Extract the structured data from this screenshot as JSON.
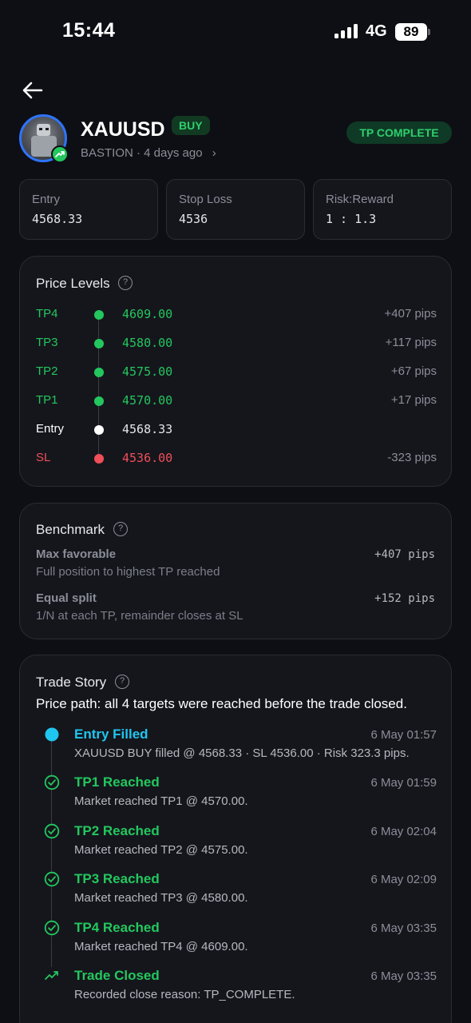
{
  "status": {
    "time": "15:44",
    "network": "4G",
    "battery": "89"
  },
  "header": {
    "symbol": "XAUUSD",
    "direction": "BUY",
    "subline": "BASTION · 4 days ago",
    "status_badge": "TP COMPLETE"
  },
  "stats": [
    {
      "label": "Entry",
      "value": "4568.33"
    },
    {
      "label": "Stop Loss",
      "value": "4536"
    },
    {
      "label": "Risk:Reward",
      "value": "1 : 1.3"
    }
  ],
  "price_levels": {
    "title": "Price Levels",
    "rows": [
      {
        "name": "TP4",
        "price": "4609.00",
        "pips": "+407 pips",
        "color": "#23c75e"
      },
      {
        "name": "TP3",
        "price": "4580.00",
        "pips": "+117 pips",
        "color": "#23c75e"
      },
      {
        "name": "TP2",
        "price": "4575.00",
        "pips": "+67 pips",
        "color": "#23c75e"
      },
      {
        "name": "TP1",
        "price": "4570.00",
        "pips": "+17 pips",
        "color": "#23c75e"
      },
      {
        "name": "Entry",
        "price": "4568.33",
        "pips": "",
        "color": "#ffffff"
      },
      {
        "name": "SL",
        "price": "4536.00",
        "pips": "-323 pips",
        "color": "#ef4f58"
      }
    ]
  },
  "benchmark": {
    "title": "Benchmark",
    "items": [
      {
        "label": "Max favorable",
        "sub": "Full position to highest TP reached",
        "value": "+407 pips"
      },
      {
        "label": "Equal split",
        "sub": "1/N at each TP, remainder closes at SL",
        "value": "+152 pips"
      }
    ]
  },
  "trade_story": {
    "title": "Trade Story",
    "summary": "Price path: all 4 targets were reached before the trade closed.",
    "events": [
      {
        "icon": "filled-dot-icon",
        "title": "Entry Filled",
        "time": "6 May 01:57",
        "desc": "XAUUSD BUY filled @ 4568.33 · SL 4536.00 · Risk 323.3 pips.",
        "color": "#1fc6ef"
      },
      {
        "icon": "check-circle-icon",
        "title": "TP1 Reached",
        "time": "6 May 01:59",
        "desc": "Market reached TP1 @ 4570.00.",
        "color": "#23c75e"
      },
      {
        "icon": "check-circle-icon",
        "title": "TP2 Reached",
        "time": "6 May 02:04",
        "desc": "Market reached TP2 @ 4575.00.",
        "color": "#23c75e"
      },
      {
        "icon": "check-circle-icon",
        "title": "TP3 Reached",
        "time": "6 May 02:09",
        "desc": "Market reached TP3 @ 4580.00.",
        "color": "#23c75e"
      },
      {
        "icon": "check-circle-icon",
        "title": "TP4 Reached",
        "time": "6 May 03:35",
        "desc": "Market reached TP4 @ 4609.00.",
        "color": "#23c75e"
      },
      {
        "icon": "trend-up-icon",
        "title": "Trade Closed",
        "time": "6 May 03:35",
        "desc": "Recorded close reason: TP_COMPLETE.",
        "color": "#23c75e"
      }
    ]
  }
}
